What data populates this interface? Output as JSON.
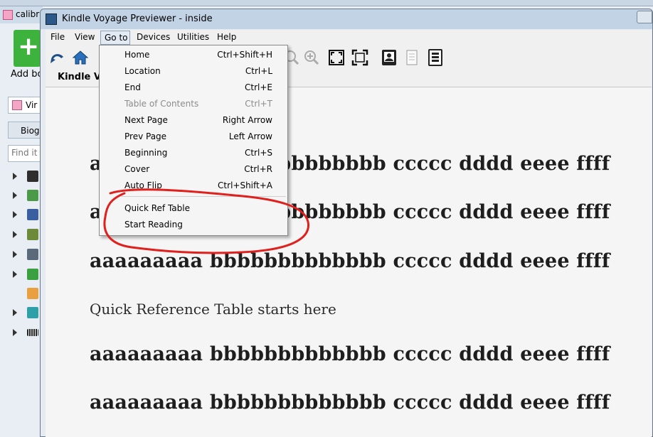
{
  "calibre": {
    "title": "calibr",
    "add_book_label": "Add bo",
    "library_label": "Vir",
    "tab_label": "Biog",
    "find_placeholder": "Find it"
  },
  "kindle": {
    "title": "Kindle Voyage Previewer - inside",
    "menu": [
      "File",
      "View",
      "Go to",
      "Devices",
      "Utilities",
      "Help"
    ],
    "content_tab": "Kindle Vo",
    "toolbar_icons": [
      "back-arrow-icon",
      "home-icon",
      "zoom-out-icon",
      "zoom-in-icon",
      "fit-page-icon",
      "fit-width-icon",
      "portrait-device-icon",
      "page-icon",
      "barcode-device-icon"
    ]
  },
  "goto_menu": {
    "items": [
      {
        "label": "Home",
        "shortcut": "Ctrl+Shift+H",
        "enabled": true
      },
      {
        "label": "Location",
        "shortcut": "Ctrl+L",
        "enabled": true
      },
      {
        "label": "End",
        "shortcut": "Ctrl+E",
        "enabled": true
      },
      {
        "label": "Table of Contents",
        "shortcut": "Ctrl+T",
        "enabled": false
      },
      {
        "label": "Next Page",
        "shortcut": "Right Arrow",
        "enabled": true
      },
      {
        "label": "Prev Page",
        "shortcut": "Left Arrow",
        "enabled": true
      },
      {
        "label": "Beginning",
        "shortcut": "Ctrl+S",
        "enabled": true
      },
      {
        "label": "Cover",
        "shortcut": "Ctrl+R",
        "enabled": true
      },
      {
        "label": "Auto Flip",
        "shortcut": "Ctrl+Shift+A",
        "enabled": true
      },
      {
        "label": "Quick Ref Table",
        "shortcut": "",
        "enabled": true
      },
      {
        "label": "Start Reading",
        "shortcut": "",
        "enabled": true
      }
    ]
  },
  "reading": {
    "lines": [
      "aaaaaaaaa bbbbbbbbbbbbb ccccc dddd eeee ffff",
      "aaaaaaaaa bbbbbbbbbbbbb ccccc dddd eeee ffff",
      "aaaaaaaaa bbbbbbbbbbbbb ccccc dddd eeee ffff",
      "Quick Reference Table starts here",
      "aaaaaaaaa bbbbbbbbbbbbb ccccc dddd eeee ffff",
      "aaaaaaaaa bbbbbbbbbbbbb ccccc dddd eeee ffff"
    ]
  },
  "annotation": {
    "color": "#e0201c"
  }
}
